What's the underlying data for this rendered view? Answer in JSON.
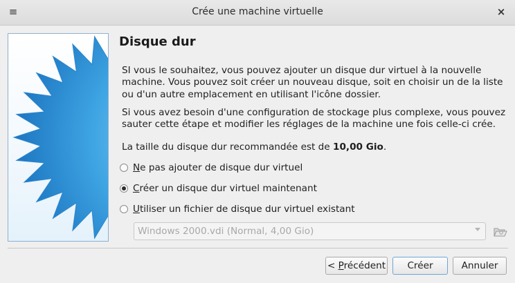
{
  "window": {
    "title": "Crée une machine virtuelle",
    "menu_glyph": "≡",
    "close_glyph": "×"
  },
  "page": {
    "heading": "Disque dur",
    "paragraph1": "SI vous le souhaitez, vous pouvez ajouter un disque dur virtuel à la nouvelle machine. Vous pouvez soit créer un nouveau disque, soit en choisir un de la liste ou d'un autre emplacement en utilisant l'icône dossier.",
    "paragraph2": "Si vous avez besoin d'une configuration de stockage plus complexe, vous pouvez sauter cette étape et modifier les réglages de la machine une fois celle-ci crée.",
    "recommended_prefix": "La taille du disque dur recommandée est de ",
    "recommended_size": "10,00 Gio",
    "recommended_suffix": "."
  },
  "options": [
    {
      "mnemonic": "N",
      "rest": "e pas ajouter de disque dur virtuel",
      "checked": false
    },
    {
      "mnemonic": "C",
      "rest": "réer un disque dur virtuel maintenant",
      "checked": true
    },
    {
      "mnemonic": "U",
      "rest": "tiliser un fichier de disque dur virtuel existant",
      "checked": false
    }
  ],
  "disk_combo": {
    "value": "Windows 2000.vdi (Normal, 4,00 Gio)",
    "enabled": false
  },
  "buttons": {
    "back_prefix": "< ",
    "back_mnemonic": "P",
    "back_rest": "récédent",
    "create": "Créer",
    "cancel": "Annuler"
  },
  "icons": {
    "menu": "menu-icon",
    "close": "close-icon",
    "folder": "folder-open-icon"
  },
  "colors": {
    "starburst_fill": "#3fa5e3",
    "starburst_edge": "#1e78c2",
    "banner_border": "#8fb0cf",
    "default_button_border": "#6fa4d6"
  }
}
